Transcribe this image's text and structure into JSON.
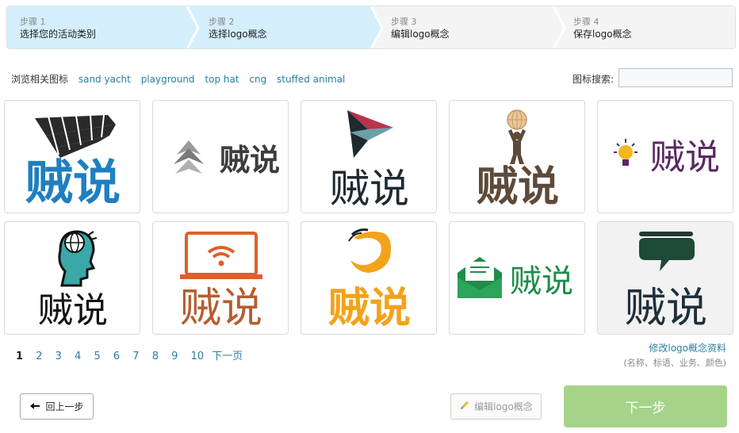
{
  "steps": [
    {
      "num": "步骤 1",
      "label": "选择您的活动类别"
    },
    {
      "num": "步骤 2",
      "label": "选择logo概念"
    },
    {
      "num": "步骤 3",
      "label": "编辑logo概念"
    },
    {
      "num": "步骤 4",
      "label": "保存logo概念"
    }
  ],
  "related": {
    "label": "浏览相关图标",
    "tags": [
      "sand yacht",
      "playground",
      "top hat",
      "cng",
      "stuffed animal"
    ]
  },
  "search": {
    "label": "图标搜索:",
    "value": ""
  },
  "logos": {
    "brand_text": "贼说",
    "items": [
      {
        "icon": "checkered-wave-icon",
        "color": "#1f7fc0"
      },
      {
        "icon": "triple-chevron-icon",
        "color": "#3d3d3d"
      },
      {
        "icon": "paper-plane-arrow-icon",
        "color": "#1f2a30"
      },
      {
        "icon": "globe-figure-icon",
        "color": "#5e4a3a"
      },
      {
        "icon": "lightbulb-icon",
        "color": "#5a2a63"
      },
      {
        "icon": "head-globe-icon",
        "color": "#111111"
      },
      {
        "icon": "laptop-wifi-icon",
        "color": "#b75d2e"
      },
      {
        "icon": "swoosh-q-icon",
        "color": "#f3a21a"
      },
      {
        "icon": "envelope-icon",
        "color": "#1f8d4a"
      },
      {
        "icon": "speech-bubble-icon",
        "color": "#1f2f3b"
      }
    ]
  },
  "pagination": {
    "pages": [
      "1",
      "2",
      "3",
      "4",
      "5",
      "6",
      "7",
      "8",
      "9",
      "10"
    ],
    "current": "1",
    "next": "下一页"
  },
  "edit_concept": {
    "link": "修改logo概念资料",
    "hint": "(名称、标语、业务、颜色)"
  },
  "buttons": {
    "back": "回上一步",
    "edit": "编辑logo概念",
    "next": "下一步"
  },
  "colors": {
    "step_active": "#d4eefc",
    "link": "#2b7fa1",
    "next_button": "#a6d38a"
  }
}
